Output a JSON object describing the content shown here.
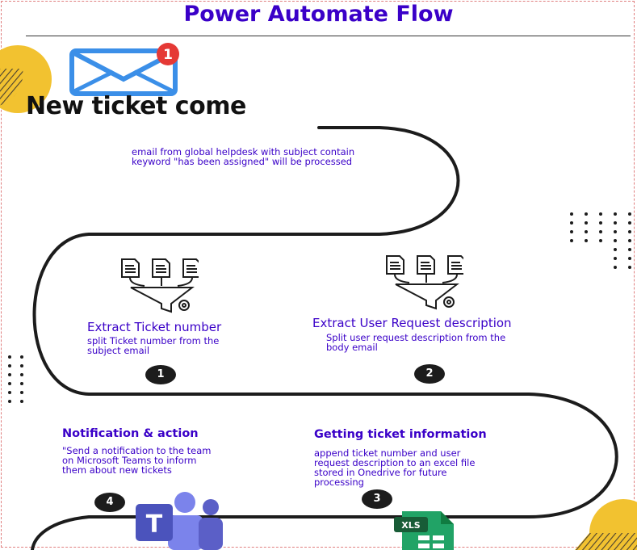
{
  "title": "Power Automate Flow",
  "trigger": {
    "headline": "New ticket come",
    "badge_count": "1",
    "description": [
      "email from global helpdesk with subject contain",
      "keyword \"has been assigned\" will be processed"
    ]
  },
  "steps": [
    {
      "number": "1",
      "title": "Extract Ticket number",
      "description": [
        "split Ticket number from the",
        "subject email"
      ]
    },
    {
      "number": "2",
      "title": "Extract User Request description",
      "description": [
        "Split user request description from the",
        "body email"
      ]
    },
    {
      "number": "3",
      "title": "Getting ticket information",
      "description": [
        "append ticket number and user",
        "request description to an excel file",
        "stored in Onedrive for future",
        "processing"
      ]
    },
    {
      "number": "4",
      "title": "Notification & action",
      "description": [
        "\"Send a notification to the team",
        "on Microsoft Teams to inform",
        "them about new tickets"
      ]
    }
  ],
  "icons": [
    "mail-icon",
    "funnel-documents-icon",
    "teams-icon",
    "excel-xls-icon"
  ],
  "icon_text": {
    "teams": "T",
    "xls": "XLS"
  },
  "colors": {
    "accent": "#3a00c8",
    "yellow": "#f2c230",
    "teams": "#5b5fc7",
    "excel": "#1e7b45",
    "mail": "#3b8fe8",
    "badge": "#e53935"
  }
}
